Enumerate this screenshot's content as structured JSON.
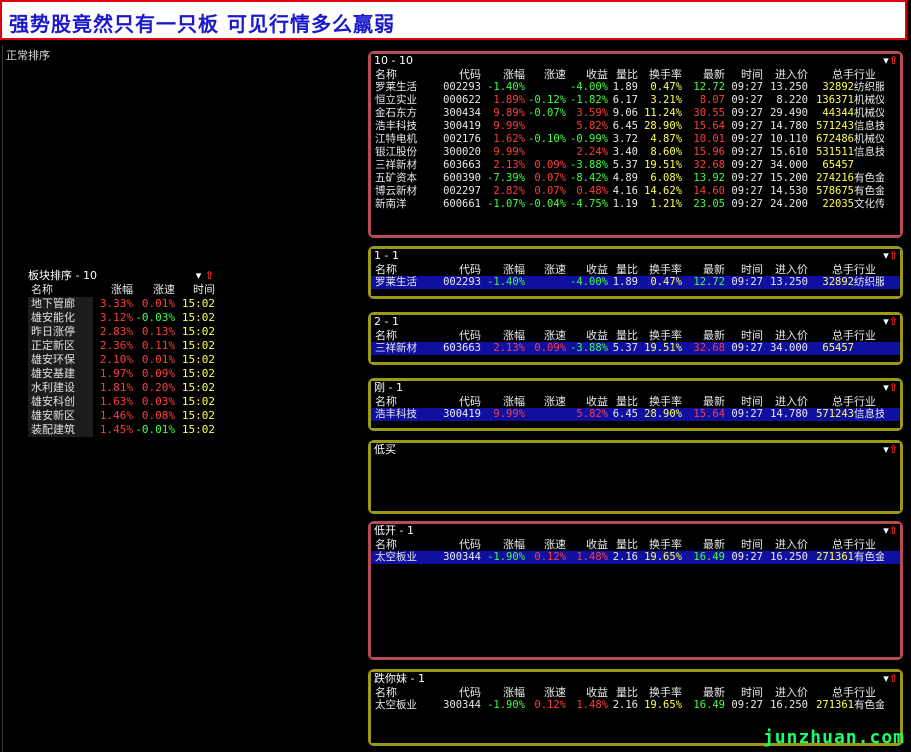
{
  "banner_title": "强势股竟然只有一只板 可见行情多么羸弱",
  "left_label": "正常排序",
  "controls": {
    "sort": "▾",
    "up": "⇧"
  },
  "colors": {
    "red_frame": "#b64b58",
    "olive_frame": "#9c9a12",
    "up": "#ff3c3c",
    "down": "#40ff40",
    "highlight": "#1010a0"
  },
  "sector": {
    "title": "板块排序 - 10",
    "headers": {
      "name": "名称",
      "chg": "涨幅",
      "spd": "涨速",
      "time": "时间"
    },
    "rows": [
      {
        "name": "地下管廊",
        "chg": "3.33%",
        "spd": "0.01%",
        "time": "15:02",
        "spd_dir": "up"
      },
      {
        "name": "雄安能化",
        "chg": "3.12%",
        "spd": "-0.03%",
        "time": "15:02",
        "spd_dir": "down"
      },
      {
        "name": "昨日涨停",
        "chg": "2.83%",
        "spd": "0.13%",
        "time": "15:02",
        "spd_dir": "up"
      },
      {
        "name": "正定新区",
        "chg": "2.36%",
        "spd": "0.11%",
        "time": "15:02",
        "spd_dir": "up"
      },
      {
        "name": "雄安环保",
        "chg": "2.10%",
        "spd": "0.01%",
        "time": "15:02",
        "spd_dir": "up"
      },
      {
        "name": "雄安基建",
        "chg": "1.97%",
        "spd": "0.09%",
        "time": "15:02",
        "spd_dir": "up"
      },
      {
        "name": "水利建设",
        "chg": "1.81%",
        "spd": "0.20%",
        "time": "15:02",
        "spd_dir": "up"
      },
      {
        "name": "雄安科创",
        "chg": "1.63%",
        "spd": "0.03%",
        "time": "15:02",
        "spd_dir": "up"
      },
      {
        "name": "雄安新区",
        "chg": "1.46%",
        "spd": "0.08%",
        "time": "15:02",
        "spd_dir": "up"
      },
      {
        "name": "装配建筑",
        "chg": "1.45%",
        "spd": "-0.01%",
        "time": "15:02",
        "spd_dir": "down"
      }
    ]
  },
  "table_headers": {
    "name": "名称",
    "code": "代码",
    "chg": "涨幅",
    "spd": "涨速",
    "ret": "收益",
    "vr": "量比",
    "tr": "换手率",
    "last": "最新",
    "time": "时间",
    "price": "进入价",
    "vol": "总手",
    "ind": "行业"
  },
  "panels": [
    {
      "title": "10 - 10",
      "frame": "red",
      "show_header": true,
      "rows": [
        {
          "name": "罗莱生活",
          "code": "002293",
          "chg": "-1.40%",
          "spd": "",
          "ret": "-4.00%",
          "vr": "1.89",
          "tr": "0.47%",
          "last": "12.72",
          "time": "09:27",
          "price": "13.250",
          "vol": "32892",
          "ind": "纺织服装",
          "cc": "g",
          "sc": "",
          "rc": "g",
          "lc": "g"
        },
        {
          "name": "恒立实业",
          "code": "000622",
          "chg": "1.89%",
          "spd": "-0.12%",
          "ret": "-1.82%",
          "vr": "6.17",
          "tr": "3.21%",
          "last": "8.07",
          "time": "09:27",
          "price": "8.220",
          "vol": "136371",
          "ind": "机械仪表",
          "cc": "r",
          "sc": "g",
          "rc": "g",
          "lc": "r"
        },
        {
          "name": "金石东方",
          "code": "300434",
          "chg": "9.89%",
          "spd": "-0.07%",
          "ret": "3.59%",
          "vr": "9.06",
          "tr": "11.24%",
          "last": "30.55",
          "time": "09:27",
          "price": "29.490",
          "vol": "44344",
          "ind": "机械仪表",
          "cc": "r",
          "sc": "g",
          "rc": "r",
          "lc": "r"
        },
        {
          "name": "浩丰科技",
          "code": "300419",
          "chg": "9.99%",
          "spd": "",
          "ret": "5.82%",
          "vr": "6.45",
          "tr": "28.90%",
          "last": "15.64",
          "time": "09:27",
          "price": "14.780",
          "vol": "571243",
          "ind": "信息技术",
          "cc": "r",
          "sc": "",
          "rc": "r",
          "lc": "r"
        },
        {
          "name": "江特电机",
          "code": "002176",
          "chg": "1.62%",
          "spd": "-0.10%",
          "ret": "-0.99%",
          "vr": "3.72",
          "tr": "4.87%",
          "last": "10.01",
          "time": "09:27",
          "price": "10.110",
          "vol": "672486",
          "ind": "机械仪表",
          "cc": "r",
          "sc": "g",
          "rc": "g",
          "lc": "r"
        },
        {
          "name": "银江股份",
          "code": "300020",
          "chg": "9.99%",
          "spd": "",
          "ret": "2.24%",
          "vr": "3.40",
          "tr": "8.60%",
          "last": "15.96",
          "time": "09:27",
          "price": "15.610",
          "vol": "531511",
          "ind": "信息技术",
          "cc": "r",
          "sc": "",
          "rc": "r",
          "lc": "r"
        },
        {
          "name": "三祥新材",
          "code": "603663",
          "chg": "2.13%",
          "spd": "0.09%",
          "ret": "-3.88%",
          "vr": "5.37",
          "tr": "19.51%",
          "last": "32.68",
          "time": "09:27",
          "price": "34.000",
          "vol": "65457",
          "ind": "",
          "cc": "r",
          "sc": "r",
          "rc": "g",
          "lc": "r"
        },
        {
          "name": "五矿资本",
          "code": "600390",
          "chg": "-7.39%",
          "spd": "0.07%",
          "ret": "-8.42%",
          "vr": "4.89",
          "tr": "6.08%",
          "last": "13.92",
          "time": "09:27",
          "price": "15.200",
          "vol": "274216",
          "ind": "有色金属材料",
          "cc": "g",
          "sc": "r",
          "rc": "g",
          "lc": "g"
        },
        {
          "name": "博云新材",
          "code": "002297",
          "chg": "2.82%",
          "spd": "0.07%",
          "ret": "0.48%",
          "vr": "4.16",
          "tr": "14.62%",
          "last": "14.60",
          "time": "09:27",
          "price": "14.530",
          "vol": "578675",
          "ind": "有色金属材料",
          "cc": "r",
          "sc": "r",
          "rc": "r",
          "lc": "r"
        },
        {
          "name": "新南洋",
          "code": "600661",
          "chg": "-1.07%",
          "spd": "-0.04%",
          "ret": "-4.75%",
          "vr": "1.19",
          "tr": "1.21%",
          "last": "23.05",
          "time": "09:27",
          "price": "24.200",
          "vol": "22035",
          "ind": "文化传播",
          "cc": "g",
          "sc": "g",
          "rc": "g",
          "lc": "g"
        }
      ]
    },
    {
      "title": "1 - 1",
      "frame": "olive",
      "show_header": true,
      "rows": [
        {
          "name": "罗莱生活",
          "code": "002293",
          "chg": "-1.40%",
          "spd": "",
          "ret": "-4.00%",
          "vr": "1.89",
          "tr": "0.47%",
          "last": "12.72",
          "time": "09:27",
          "price": "13.250",
          "vol": "32892",
          "ind": "纺织服装",
          "cc": "g",
          "sc": "",
          "rc": "g",
          "lc": "g",
          "selected": true
        }
      ]
    },
    {
      "title": "2 - 1",
      "frame": "olive",
      "show_header": true,
      "rows": [
        {
          "name": "三祥新材",
          "code": "603663",
          "chg": "2.13%",
          "spd": "0.09%",
          "ret": "-3.88%",
          "vr": "5.37",
          "tr": "19.51%",
          "last": "32.68",
          "time": "09:27",
          "price": "34.000",
          "vol": "65457",
          "ind": "",
          "cc": "r",
          "sc": "r",
          "rc": "g",
          "lc": "r",
          "selected": true
        }
      ]
    },
    {
      "title": "刚 - 1",
      "frame": "olive",
      "show_header": true,
      "rows": [
        {
          "name": "浩丰科技",
          "code": "300419",
          "chg": "9.99%",
          "spd": "",
          "ret": "5.82%",
          "vr": "6.45",
          "tr": "28.90%",
          "last": "15.64",
          "time": "09:27",
          "price": "14.780",
          "vol": "571243",
          "ind": "信息技术",
          "cc": "r",
          "sc": "",
          "rc": "r",
          "lc": "r",
          "selected": true
        }
      ]
    },
    {
      "title": "低买",
      "frame": "olive",
      "show_header": false,
      "rows": []
    },
    {
      "title": "低开 - 1",
      "frame": "red",
      "show_header": true,
      "rows": [
        {
          "name": "太空板业",
          "code": "300344",
          "chg": "-1.90%",
          "spd": "0.12%",
          "ret": "1.48%",
          "vr": "2.16",
          "tr": "19.65%",
          "last": "16.49",
          "time": "09:27",
          "price": "16.250",
          "vol": "271361",
          "ind": "有色金属材料",
          "cc": "g",
          "sc": "r",
          "rc": "r",
          "lc": "g",
          "selected": true
        }
      ]
    },
    {
      "title": "跌你妹 - 1",
      "frame": "olive",
      "show_header": true,
      "rows": [
        {
          "name": "太空板业",
          "code": "300344",
          "chg": "-1.90%",
          "spd": "0.12%",
          "ret": "1.48%",
          "vr": "2.16",
          "tr": "19.65%",
          "last": "16.49",
          "time": "09:27",
          "price": "16.250",
          "vol": "271361",
          "ind": "有色金属材料",
          "cc": "g",
          "sc": "r",
          "rc": "r",
          "lc": "g",
          "selected": false
        }
      ]
    }
  ],
  "watermark": "junzhuan.com"
}
